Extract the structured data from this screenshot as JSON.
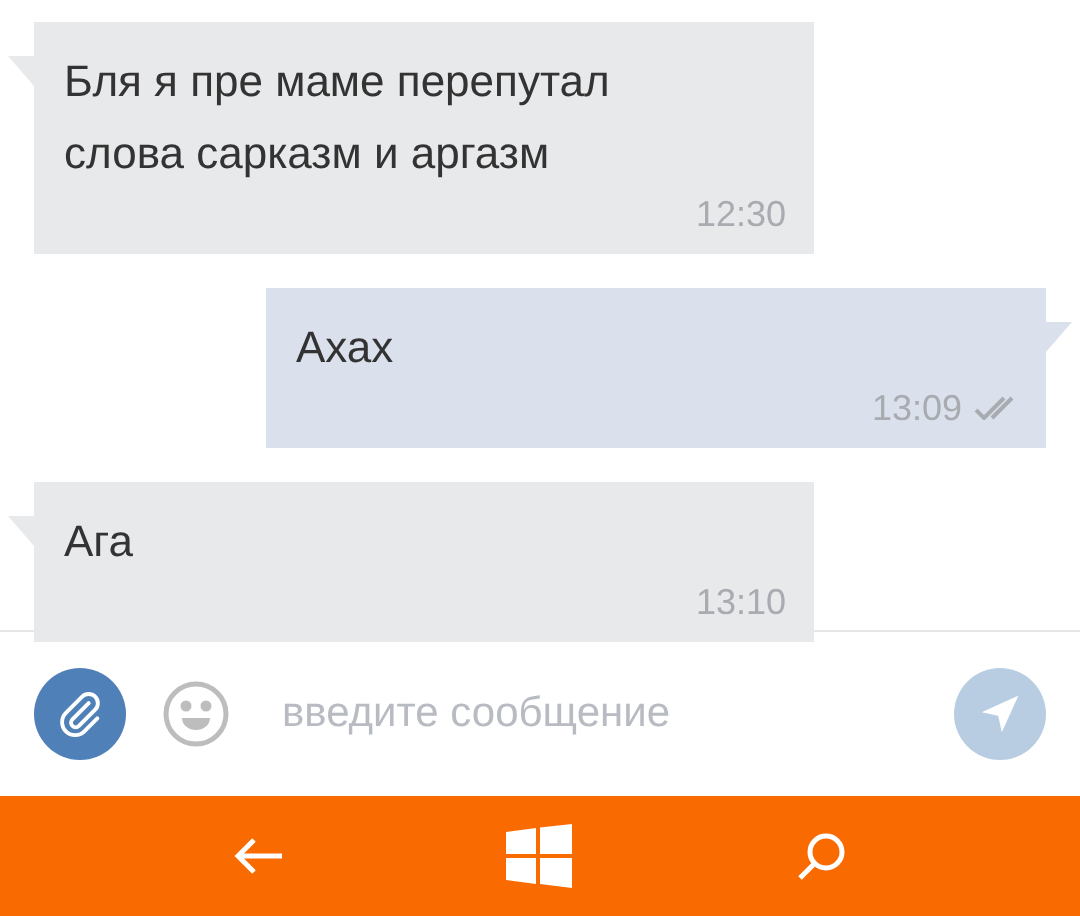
{
  "messages": [
    {
      "kind": "incoming",
      "text": "Бля я пре маме перепутал слова сарказм и аргазм",
      "time": "12:30"
    },
    {
      "kind": "outgoing",
      "text": "Ахах",
      "time": "13:09",
      "read": true
    },
    {
      "kind": "incoming",
      "text": "Ага",
      "time": "13:10"
    }
  ],
  "composer": {
    "placeholder": "введите сообщение"
  }
}
